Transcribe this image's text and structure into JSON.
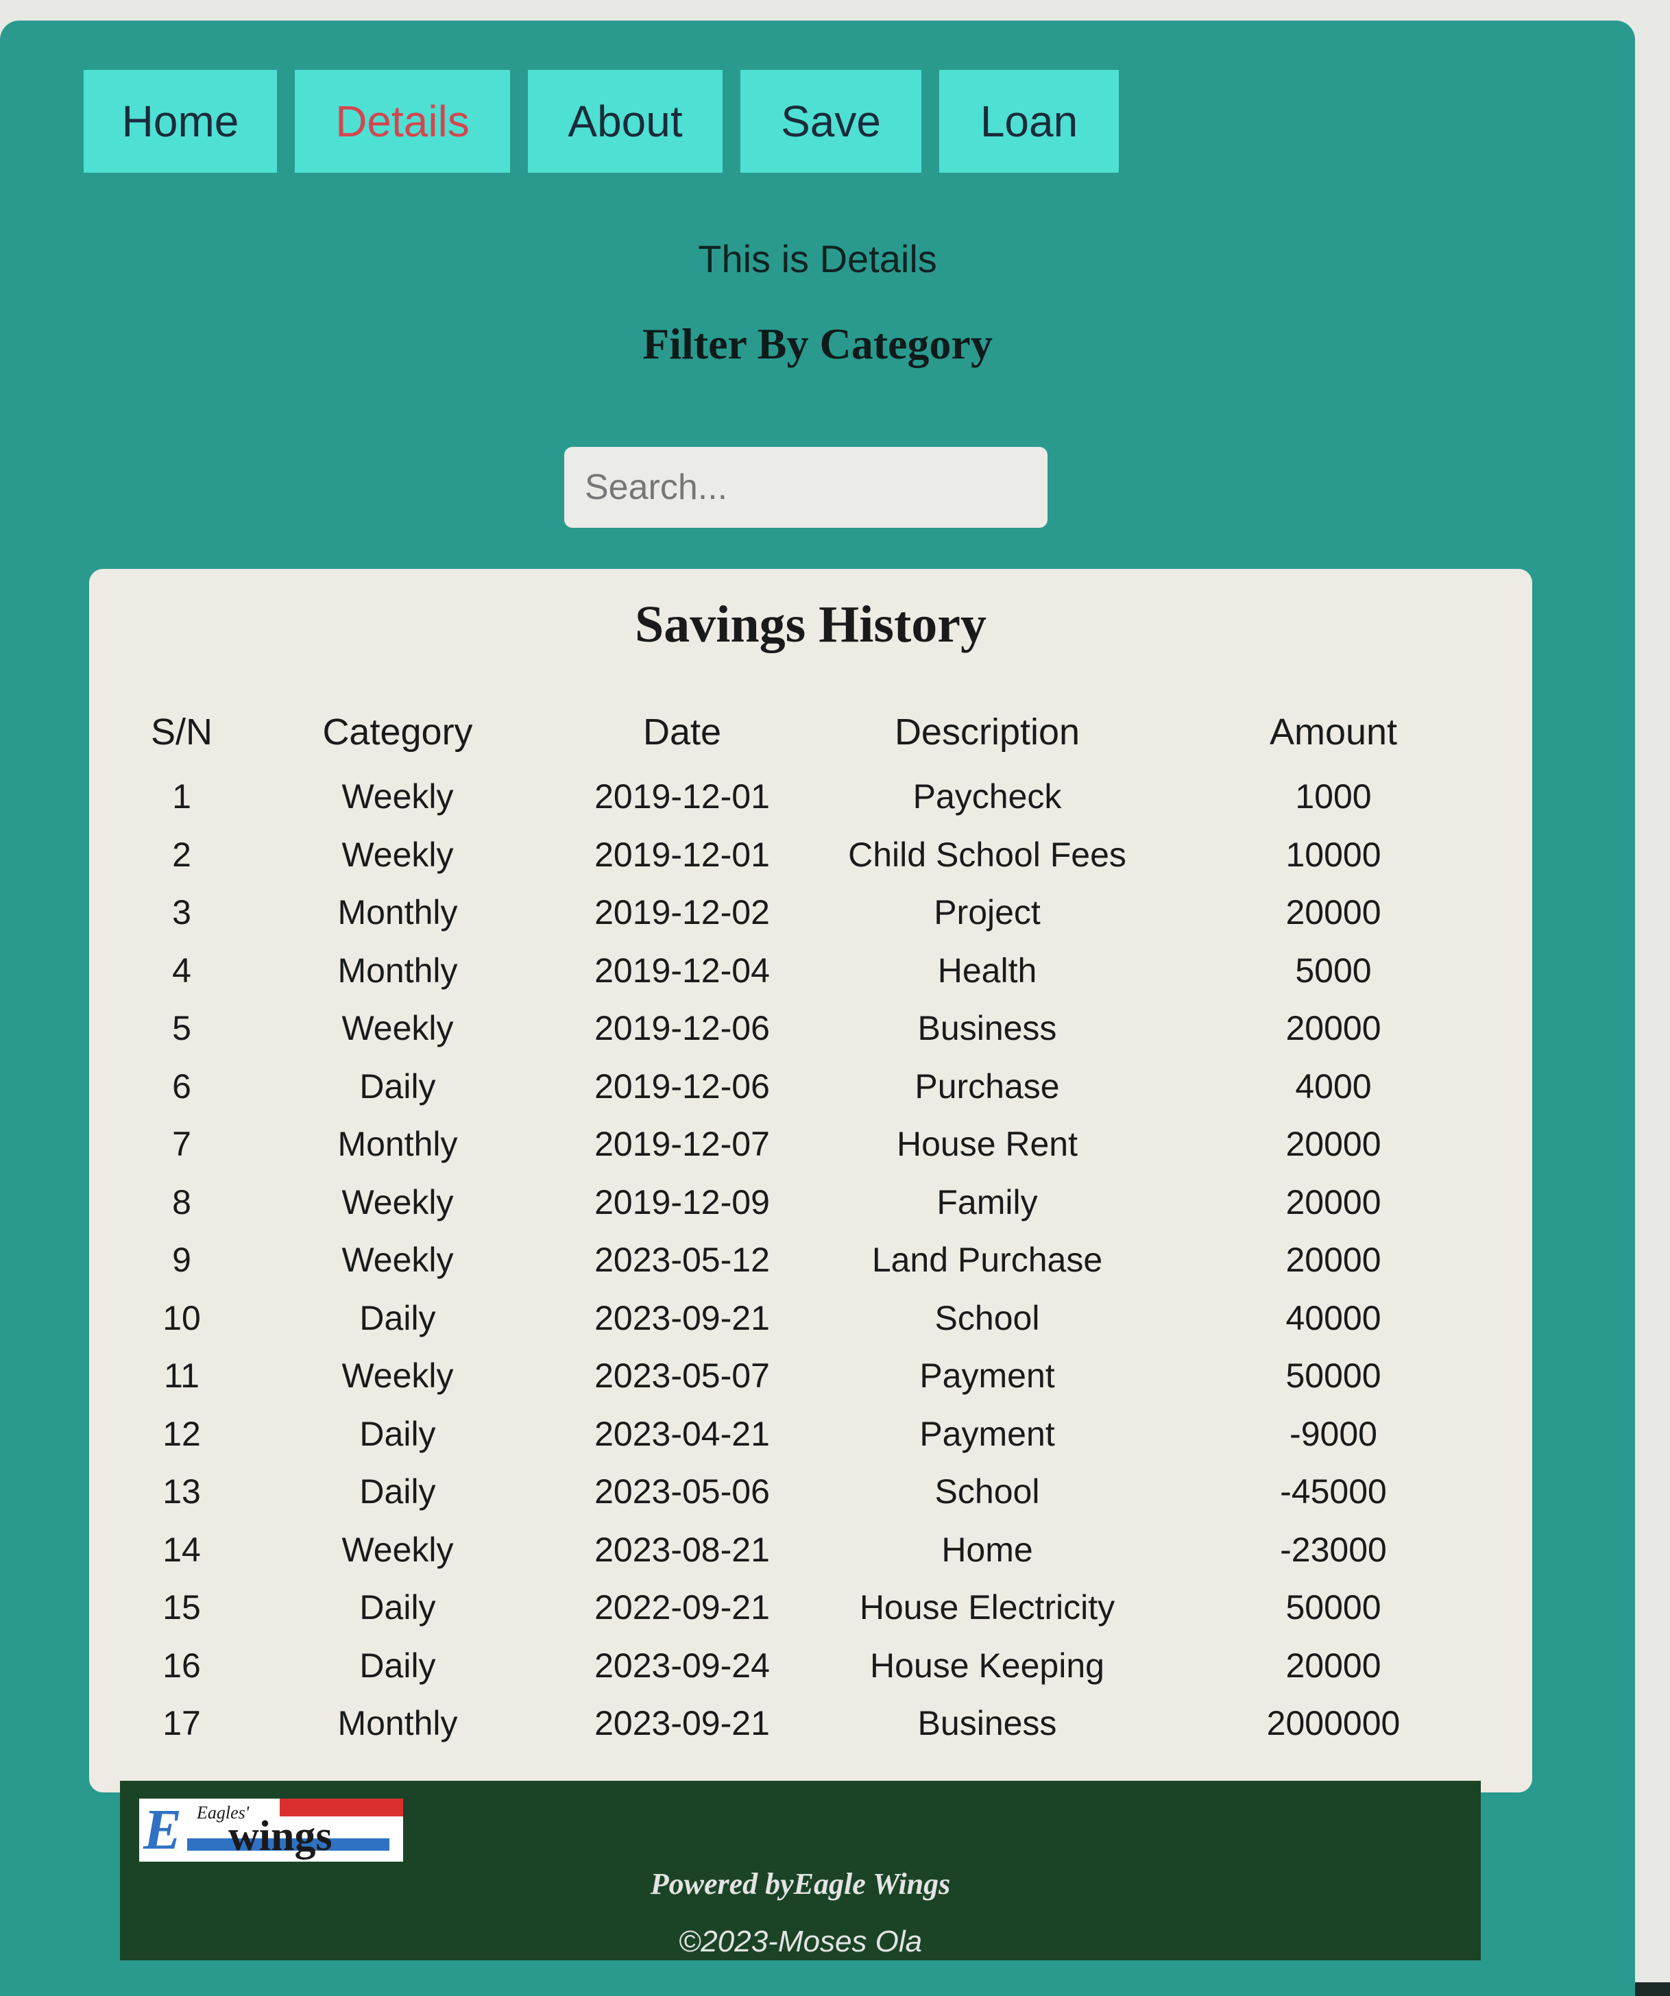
{
  "nav": {
    "items": [
      {
        "label": "Home"
      },
      {
        "label": "Details"
      },
      {
        "label": "About"
      },
      {
        "label": "Save"
      },
      {
        "label": "Loan"
      }
    ],
    "active": "Details",
    "active_color": "#d4464f"
  },
  "page": {
    "subtitle": "This is Details",
    "filter_heading": "Filter By Category"
  },
  "search": {
    "placeholder": "Search..."
  },
  "history": {
    "title": "Savings History",
    "columns": [
      "S/N",
      "Category",
      "Date",
      "Description",
      "Amount"
    ],
    "rows": [
      [
        "1",
        "Weekly",
        "2019-12-01",
        "Paycheck",
        "1000"
      ],
      [
        "2",
        "Weekly",
        "2019-12-01",
        "Child School Fees",
        "10000"
      ],
      [
        "3",
        "Monthly",
        "2019-12-02",
        "Project",
        "20000"
      ],
      [
        "4",
        "Monthly",
        "2019-12-04",
        "Health",
        "5000"
      ],
      [
        "5",
        "Weekly",
        "2019-12-06",
        "Business",
        "20000"
      ],
      [
        "6",
        "Daily",
        "2019-12-06",
        "Purchase",
        "4000"
      ],
      [
        "7",
        "Monthly",
        "2019-12-07",
        "House Rent",
        "20000"
      ],
      [
        "8",
        "Weekly",
        "2019-12-09",
        "Family",
        "20000"
      ],
      [
        "9",
        "Weekly",
        "2023-05-12",
        "Land Purchase",
        "20000"
      ],
      [
        "10",
        "Daily",
        "2023-09-21",
        "School",
        "40000"
      ],
      [
        "11",
        "Weekly",
        "2023-05-07",
        "Payment",
        "50000"
      ],
      [
        "12",
        "Daily",
        "2023-04-21",
        "Payment",
        "-9000"
      ],
      [
        "13",
        "Daily",
        "2023-05-06",
        "School",
        "-45000"
      ],
      [
        "14",
        "Weekly",
        "2023-08-21",
        "Home",
        "-23000"
      ],
      [
        "15",
        "Daily",
        "2022-09-21",
        "House Electricity",
        "50000"
      ],
      [
        "16",
        "Daily",
        "2023-09-24",
        "House Keeping",
        "20000"
      ],
      [
        "17",
        "Monthly",
        "2023-09-21",
        "Business",
        "2000000"
      ]
    ]
  },
  "footer": {
    "logo_small": "Eagles'",
    "logo_mark": "E",
    "logo_word": "wings",
    "powered_prefix": "Powered by",
    "powered_name": "Eagle Wings",
    "copyright": "©2023-Moses Ola"
  },
  "colors": {
    "panel": "#2a9a8e",
    "nav_button": "#4ee0d2",
    "card": "#eeebe4",
    "footer": "#1b4427"
  }
}
